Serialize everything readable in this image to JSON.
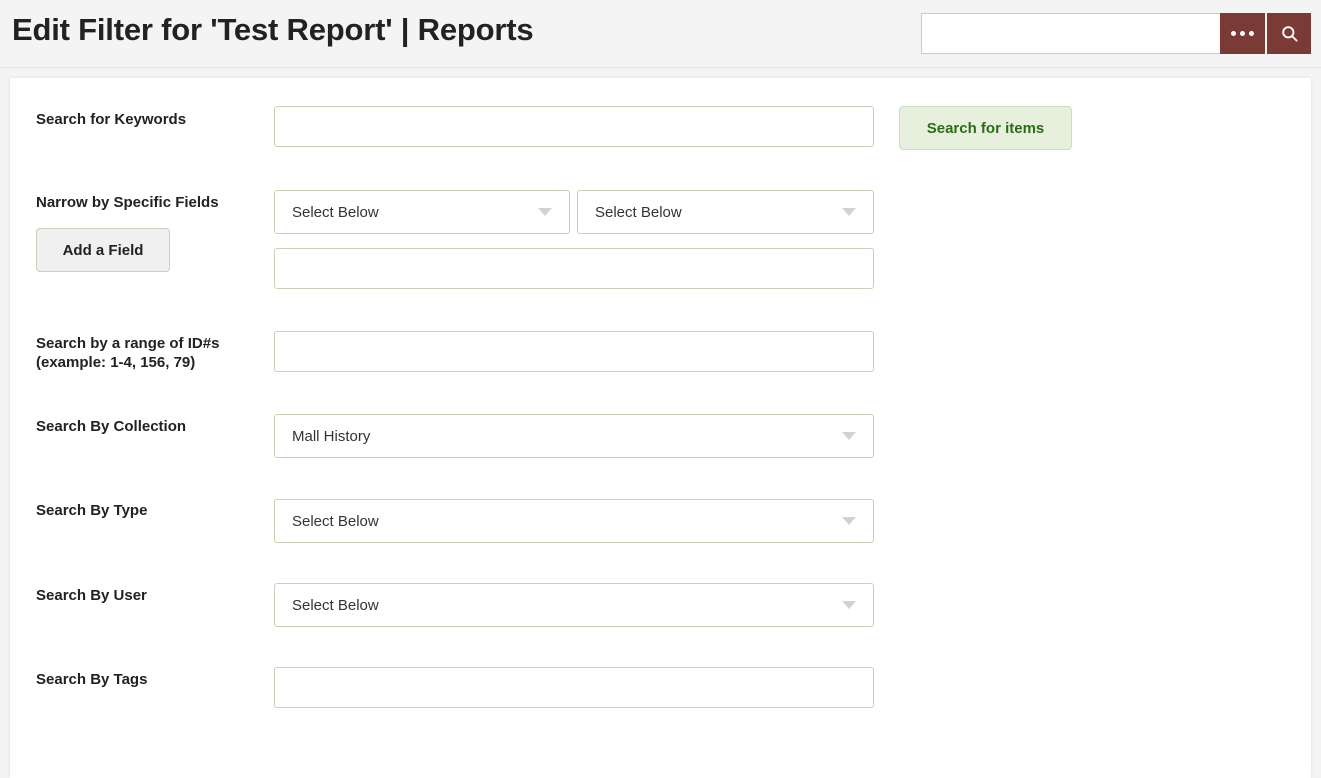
{
  "header": {
    "title": "Edit Filter for 'Test Report' | Reports",
    "search": {
      "value": "",
      "placeholder": "",
      "more_icon": "ellipsis-icon",
      "search_icon": "search-icon"
    },
    "colors": {
      "button_bg": "#7a3b36",
      "page_bg": "#f4f4f4"
    }
  },
  "form": {
    "keywords": {
      "label": "Search for Keywords",
      "value": "",
      "placeholder": ""
    },
    "search_button": {
      "label": "Search for items"
    },
    "narrow_fields": {
      "label": "Narrow by Specific Fields",
      "add_button": "Add a Field",
      "select_one": "Select Below",
      "select_two": "Select Below",
      "value_input": "",
      "value_placeholder": ""
    },
    "id_range": {
      "label_line1": "Search by a range of ID#s",
      "label_line2": "(example: 1-4, 156, 79)",
      "value": "",
      "placeholder": ""
    },
    "collection": {
      "label": "Search By Collection",
      "selected": "Mall History"
    },
    "type": {
      "label": "Search By Type",
      "selected": "Select Below"
    },
    "user": {
      "label": "Search By User",
      "selected": "Select Below"
    },
    "tags": {
      "label": "Search By Tags",
      "value": "",
      "placeholder": ""
    }
  },
  "colors": {
    "accent_green_text": "#2c6b18",
    "accent_green_bg": "#e6f0dc",
    "field_border": "#cfcdb6",
    "brand_dark_red": "#7a3b36"
  }
}
